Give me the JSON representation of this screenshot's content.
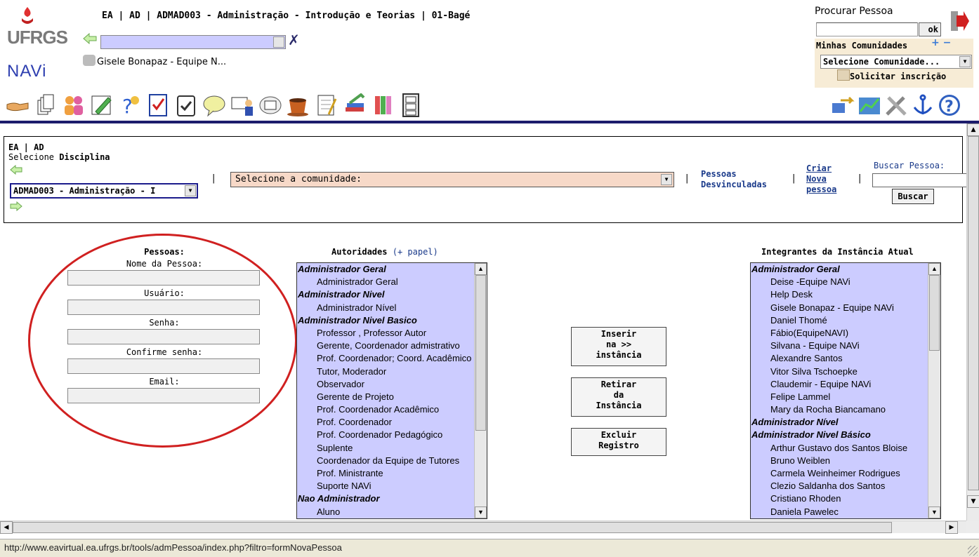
{
  "header": {
    "logo_text": "UFRGS",
    "navi_logo": "NAVi",
    "course_title": "EA | AD | ADMAD003 - Administração - Introdução e Teorias | 01-Bagé",
    "user_label": "Gisele Bonapaz - Equipe N...",
    "search_person": {
      "label": "Procurar Pessoa",
      "ok_label": "ok"
    },
    "my_communities": {
      "title": "Minhas Comunidades",
      "select_value": "Selecione Comunidade...",
      "request_label": "Solicitar inscrição"
    },
    "toolbar_left_icons": [
      "handshake-icon",
      "pages-icon",
      "people-icon",
      "pencil-icon",
      "question-icon",
      "checklist-icon",
      "clipboard-icon",
      "chat-bubble-icon",
      "teacher-icon",
      "news-icon",
      "coffee-icon",
      "notepad-icon",
      "books-icon",
      "library-icon",
      "cabinet-icon"
    ],
    "toolbar_right_icons": [
      "transfer-icon",
      "stats-icon",
      "tools-icon",
      "anchor-icon",
      "help-icon"
    ],
    "colors": {
      "navbar": "#1c1c6c",
      "accent_link": "#1a3a8a",
      "list_bg": "#ccccff"
    }
  },
  "filters": {
    "breadcrumb": "EA | AD",
    "select_prefix": "Selecione",
    "select_bold": "Disciplina",
    "discipline_value": "ADMAD003 - Administração - I",
    "community_value": "Selecione a comunidade:",
    "unlinked_people": [
      "Pessoas",
      "Desvinculadas"
    ],
    "create_person": [
      "Criar",
      "Nova",
      "pessoa"
    ],
    "search_label": "Buscar Pessoa:",
    "search_button": "Buscar"
  },
  "form": {
    "title": "Pessoas:",
    "fields": [
      "Nome da Pessoa:",
      "Usuário:",
      "Senha:",
      "Confirme senha:",
      "Email:"
    ]
  },
  "authorities": {
    "title": "Autoridades",
    "add_role": "(+ papel)",
    "items": [
      {
        "text": "Administrador Geral",
        "group": true
      },
      {
        "text": "Administrador Geral",
        "group": false
      },
      {
        "text": "Administrador Nivel",
        "group": true
      },
      {
        "text": "Administrador Nível",
        "group": false
      },
      {
        "text": "Administrador Nivel Basico",
        "group": true
      },
      {
        "text": "Professor , Professor Autor",
        "group": false
      },
      {
        "text": "Gerente, Coordenador admistrativo",
        "group": false
      },
      {
        "text": "Prof. Coordenador; Coord. Acadêmico",
        "group": false
      },
      {
        "text": "Tutor, Moderador",
        "group": false
      },
      {
        "text": "Observador",
        "group": false
      },
      {
        "text": "Gerente de Projeto",
        "group": false
      },
      {
        "text": "Prof. Coordenador Acadêmico",
        "group": false
      },
      {
        "text": "Prof. Coordenador",
        "group": false
      },
      {
        "text": "Prof. Coordenador Pedagógico",
        "group": false
      },
      {
        "text": "Suplente",
        "group": false
      },
      {
        "text": "Coordenador da Equipe de Tutores",
        "group": false
      },
      {
        "text": "Prof. Ministrante",
        "group": false
      },
      {
        "text": "Suporte NAVi",
        "group": false
      },
      {
        "text": "Nao Administrador",
        "group": true
      },
      {
        "text": "Aluno",
        "group": false
      }
    ]
  },
  "actions": {
    "insert": [
      "Inserir",
      "na >>",
      "instância"
    ],
    "remove": [
      "Retirar",
      "da",
      "Instância"
    ],
    "delete": [
      "Excluir",
      "Registro"
    ]
  },
  "members": {
    "title": "Integrantes da Instância Atual",
    "items": [
      {
        "text": "Administrador Geral",
        "group": true
      },
      {
        "text": "Deise -Equipe NAVi",
        "group": false
      },
      {
        "text": "Help Desk",
        "group": false
      },
      {
        "text": "Gisele Bonapaz - Equipe NAVi",
        "group": false
      },
      {
        "text": "Daniel Thomé",
        "group": false
      },
      {
        "text": "Fábio(EquipeNAVI)",
        "group": false
      },
      {
        "text": "Silvana - Equipe NAVi",
        "group": false
      },
      {
        "text": "Alexandre Santos",
        "group": false
      },
      {
        "text": "Vitor Silva Tschoepke",
        "group": false
      },
      {
        "text": "Claudemir - Equipe NAVi",
        "group": false
      },
      {
        "text": "Felipe Lammel",
        "group": false
      },
      {
        "text": "Mary da Rocha Biancamano",
        "group": false
      },
      {
        "text": "Administrador Nível",
        "group": true
      },
      {
        "text": "Administrador Nivel Básico",
        "group": true
      },
      {
        "text": "Arthur Gustavo dos Santos Bloise",
        "group": false
      },
      {
        "text": "Bruno Weiblen",
        "group": false
      },
      {
        "text": "Carmela Weinheimer Rodrigues",
        "group": false
      },
      {
        "text": "Clezio Saldanha dos Santos",
        "group": false
      },
      {
        "text": "Cristiano Rhoden",
        "group": false
      },
      {
        "text": "Daniela Pawelec",
        "group": false
      }
    ]
  },
  "status_url": "http://www.eavirtual.ea.ufrgs.br/tools/admPessoa/index.php?filtro=formNovaPessoa"
}
